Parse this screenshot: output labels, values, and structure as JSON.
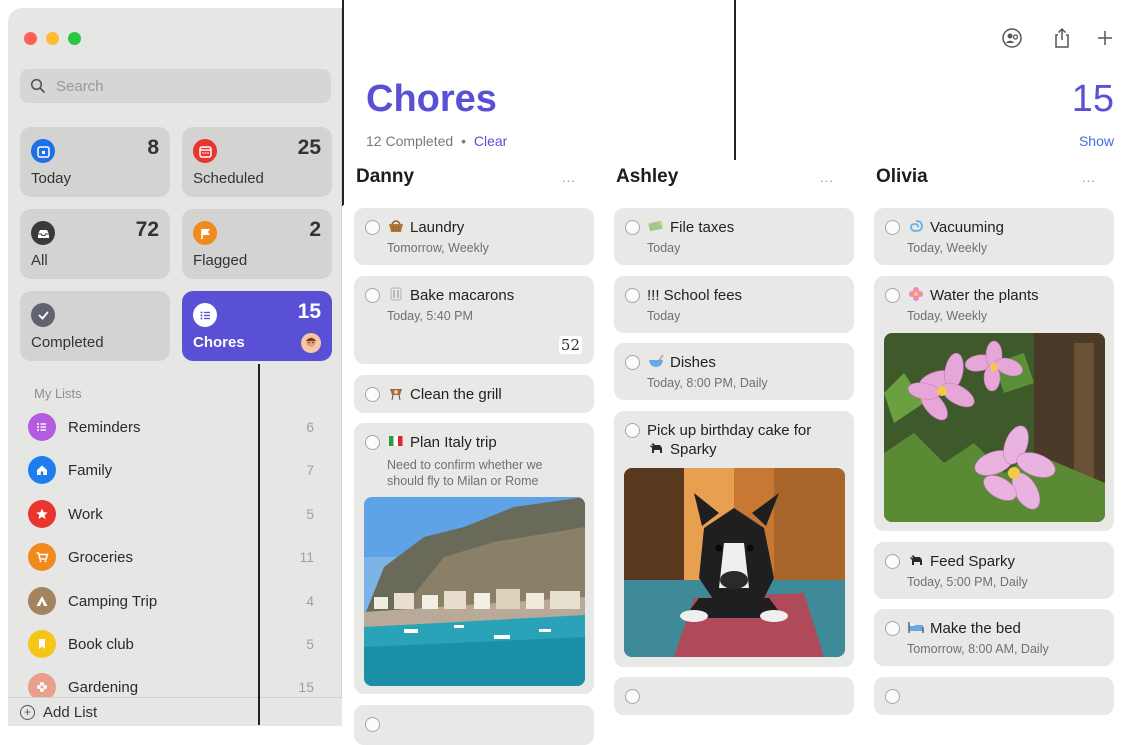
{
  "sidebar": {
    "search_placeholder": "Search",
    "smart_lists": [
      {
        "label": "Today",
        "count": "8",
        "icon": "calendar-icon",
        "color": "#1e6fe8"
      },
      {
        "label": "Scheduled",
        "count": "25",
        "icon": "calendar-grid-icon",
        "color": "#e8352e"
      },
      {
        "label": "All",
        "count": "72",
        "icon": "tray-icon",
        "color": "#3a3a3a"
      },
      {
        "label": "Flagged",
        "count": "2",
        "icon": "flag-icon",
        "color": "#f08a1c"
      },
      {
        "label": "Completed",
        "count": "",
        "icon": "checkmark-icon",
        "color": "#5f6470"
      },
      {
        "label": "Chores",
        "count": "15",
        "icon": "list-icon",
        "color": "#5a50d6"
      }
    ],
    "my_lists_header": "My Lists",
    "lists": [
      {
        "label": "Reminders",
        "count": "6",
        "icon": "list-icon",
        "color": "#b45ce0"
      },
      {
        "label": "Family",
        "count": "7",
        "icon": "house-icon",
        "color": "#1e7ef0"
      },
      {
        "label": "Work",
        "count": "5",
        "icon": "star-icon",
        "color": "#e8352e"
      },
      {
        "label": "Groceries",
        "count": "11",
        "icon": "cart-icon",
        "color": "#f08a1c"
      },
      {
        "label": "Camping Trip",
        "count": "4",
        "icon": "tent-icon",
        "color": "#a2845e"
      },
      {
        "label": "Book club",
        "count": "5",
        "icon": "bookmark-icon",
        "color": "#f5c518"
      },
      {
        "label": "Gardening",
        "count": "15",
        "icon": "flower-icon",
        "color": "#e8a08c"
      }
    ],
    "add_list_label": "Add List"
  },
  "main": {
    "title": "Chores",
    "count": "15",
    "completed_text": "12 Completed",
    "separator": "•",
    "clear_label": "Clear",
    "show_label": "Show",
    "more_label": "...",
    "columns": [
      {
        "name": "Danny",
        "tasks": [
          {
            "title": "Laundry",
            "subtitle": "Tomorrow, Weekly",
            "icon": "basket-icon"
          },
          {
            "title": "Bake macarons",
            "subtitle": "Today, 5:40 PM",
            "icon": "fork-knife-icon",
            "badge": "52"
          },
          {
            "title": "Clean the grill",
            "subtitle": "",
            "icon": "grill-icon"
          },
          {
            "title": "Plan Italy trip",
            "subtitle": "",
            "note": "Need to confirm whether we should fly to Milan or Rome",
            "icon": "italy-flag-icon"
          }
        ]
      },
      {
        "name": "Ashley",
        "tasks": [
          {
            "title": "File taxes",
            "subtitle": "Today",
            "icon": "money-icon"
          },
          {
            "title": "!!! School fees",
            "subtitle": "Today"
          },
          {
            "title": "Dishes",
            "subtitle": "Today, 8:00 PM, Daily",
            "icon": "bowl-icon"
          },
          {
            "title": "Pick up birthday cake for",
            "title2": "Sparky",
            "icon": "dog-icon"
          }
        ]
      },
      {
        "name": "Olivia",
        "tasks": [
          {
            "title": "Vacuuming",
            "subtitle": "Today, Weekly",
            "icon": "swirl-icon"
          },
          {
            "title": "Water the plants",
            "subtitle": "Today, Weekly",
            "icon": "blossom-icon"
          },
          {
            "title": "Feed Sparky",
            "subtitle": "Today, 5:00 PM, Daily",
            "icon": "dog-icon"
          },
          {
            "title": "Make the bed",
            "subtitle": "Tomorrow, 8:00 AM, Daily",
            "icon": "bed-icon"
          }
        ]
      }
    ]
  }
}
